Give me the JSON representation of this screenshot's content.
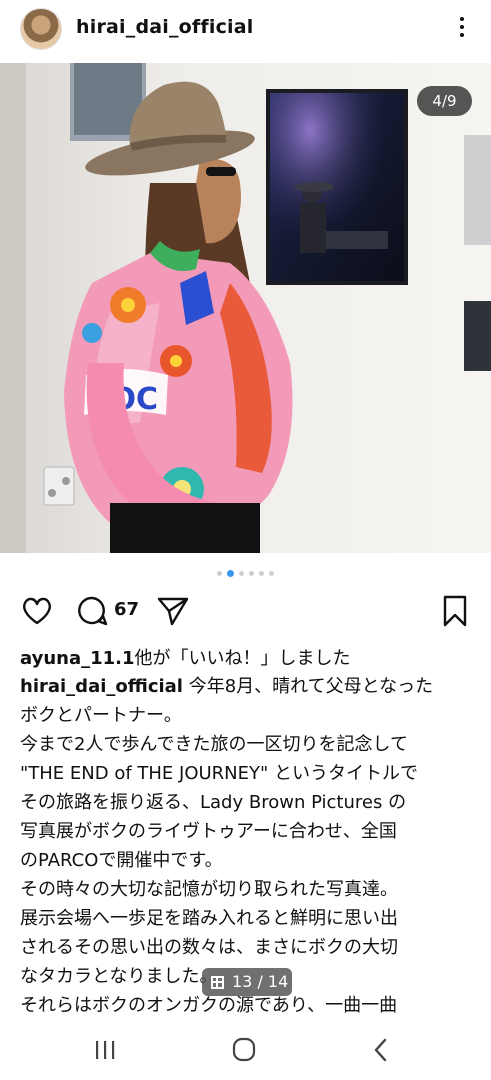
{
  "post": {
    "username": "hirai_dai_official",
    "counter": "4/9",
    "like_count": "67",
    "liked_by_user": "ayuna_11.1",
    "liked_by_text": "他が「いいね！」しました",
    "author": "hirai_dai_official",
    "caption_lines": [
      "今年8月、晴れて父母となった",
      "ボクとパートナー。",
      "今まで2人で歩んできた旅の一区切りを記念して",
      "\"THE END of THE JOURNEY\" というタイトルで",
      "その旅路を振り返る、Lady Brown Pictures の",
      "写真展がボクのライヴトゥアーに合わせ、全国",
      "のPARCOで開催中です。",
      "その時々の大切な記憶が切り取られた写真達。",
      "展示会場へ一歩足を踏み入れると鮮明に思い出",
      "されるその思い出の数々は、まさにボクの大切",
      "なタカラとなりました。",
      "それらはボクのオンガクの源であり、一曲一曲"
    ],
    "screenshot_badge": "13 / 14"
  },
  "carousel": {
    "total_dots": 6,
    "active_index": 1
  },
  "icons": {
    "more": "more-vertical-icon",
    "like": "heart-icon",
    "comment": "comment-icon",
    "share": "send-icon",
    "save": "bookmark-icon",
    "nav_recent": "recent-apps-icon",
    "nav_home": "home-icon",
    "nav_back": "back-icon"
  },
  "colors": {
    "accent": "#3897f0",
    "text": "#111111"
  }
}
